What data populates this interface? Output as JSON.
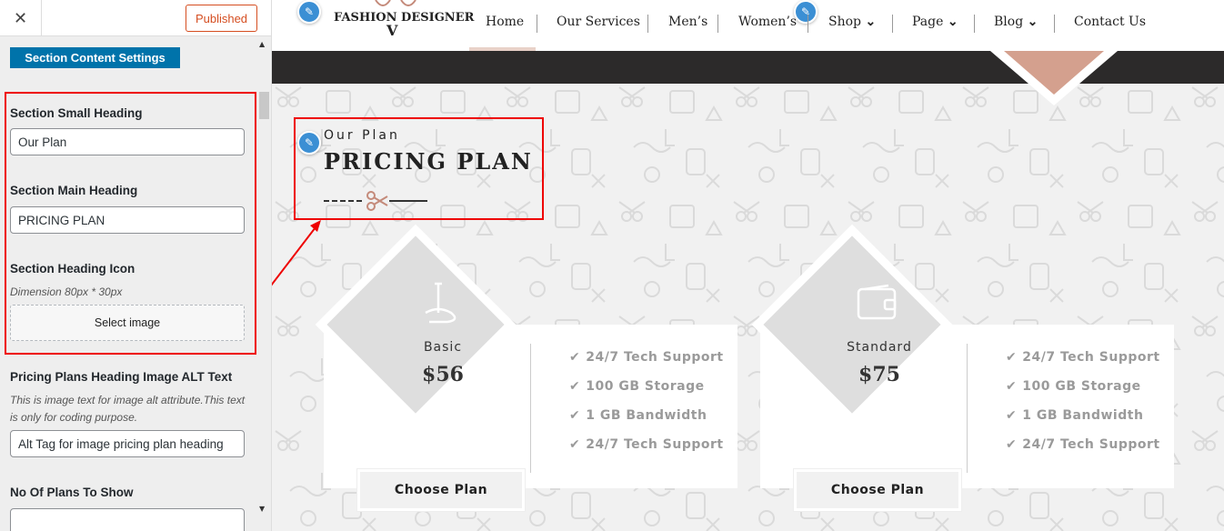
{
  "sidebar": {
    "close_glyph": "✕",
    "published_label": "Published",
    "section_button": "Section Content Settings",
    "small_heading": {
      "label": "Section Small Heading",
      "value": "Our Plan"
    },
    "main_heading": {
      "label": "Section Main Heading",
      "value": "PRICING PLAN"
    },
    "heading_icon": {
      "label": "Section Heading Icon",
      "desc": "Dimension 80px * 30px",
      "button": "Select image"
    },
    "alt_text": {
      "label": "Pricing Plans Heading Image ALT Text",
      "desc": "This is image text for image alt attribute.This text is only for coding purpose.",
      "value": "Alt Tag for image pricing plan heading"
    },
    "plans_count": {
      "label": "No Of Plans To Show"
    }
  },
  "site": {
    "logo": "FASHION DESIGNER",
    "logo_mark": "V",
    "nav": [
      {
        "label": "Home",
        "dropdown": false
      },
      {
        "label": "Our Services",
        "dropdown": false
      },
      {
        "label": "Men’s",
        "dropdown": false
      },
      {
        "label": "Women’s",
        "dropdown": false
      },
      {
        "label": "Shop",
        "dropdown": true
      },
      {
        "label": "Page",
        "dropdown": true
      },
      {
        "label": "Blog",
        "dropdown": true
      },
      {
        "label": "Contact Us",
        "dropdown": false
      }
    ],
    "chevron": "⌄",
    "accent_color": "#d4a08e"
  },
  "pricing": {
    "small_heading": "Our Plan",
    "main_heading": "PRICING PLAN",
    "plans": [
      {
        "name": "Basic",
        "price": "$56",
        "icon": "sewing-needle-icon",
        "features": [
          "24/7 Tech Support",
          "100 GB Storage",
          "1 GB Bandwidth",
          "24/7 Tech Support"
        ],
        "button": "Choose Plan"
      },
      {
        "name": "Standard",
        "price": "$75",
        "icon": "wallet-icon",
        "features": [
          "24/7 Tech Support",
          "100 GB Storage",
          "1 GB Bandwidth",
          "24/7 Tech Support"
        ],
        "button": "Choose Plan"
      }
    ],
    "check_glyph": "✔"
  }
}
